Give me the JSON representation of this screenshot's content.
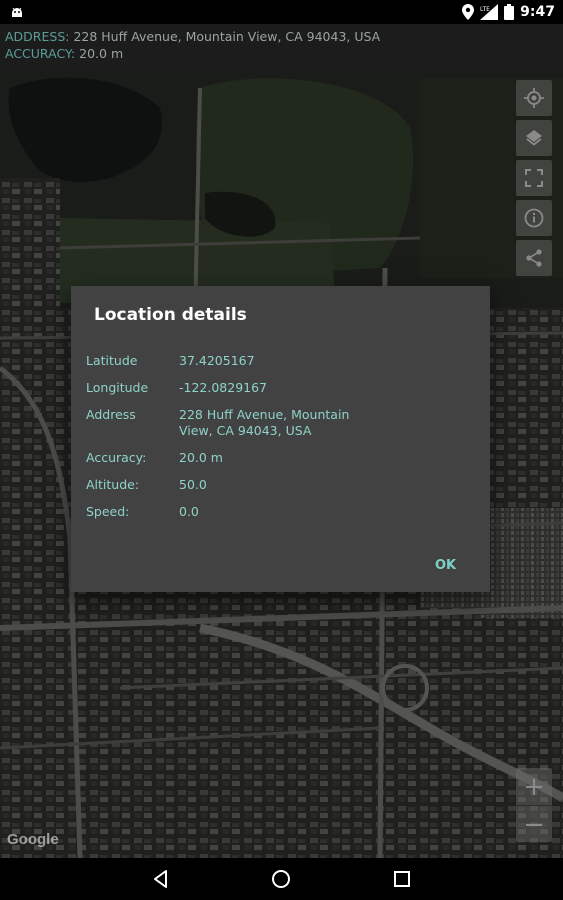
{
  "status_bar": {
    "time": "9:47",
    "network": "LTE",
    "icons": [
      "android-icon",
      "location-icon",
      "signal-icon",
      "battery-icon"
    ]
  },
  "info_header": {
    "address_label": "ADDRESS:",
    "address_value": "228 Huff Avenue, Mountain View, CA 94043, USA",
    "accuracy_label": "ACCURACY:",
    "accuracy_value": "20.0 m"
  },
  "map": {
    "type": "satellite",
    "attribution": "Google",
    "controls": [
      "my-location-icon",
      "layers-icon",
      "fullscreen-icon",
      "info-icon",
      "share-icon"
    ],
    "zoom_in": "+",
    "zoom_out": "−"
  },
  "dialog": {
    "title": "Location details",
    "rows": [
      {
        "label": "Latitude",
        "value": "37.4205167"
      },
      {
        "label": "Longitude",
        "value": "-122.0829167"
      },
      {
        "label": "Address",
        "value": "228 Huff Avenue, Mountain View, CA 94043, USA"
      },
      {
        "label": "Accuracy:",
        "value": "20.0 m"
      },
      {
        "label": "Altitude:",
        "value": "50.0"
      },
      {
        "label": "Speed:",
        "value": "0.0"
      }
    ],
    "ok_label": "OK"
  },
  "nav_bar": {
    "icons": [
      "back-icon",
      "home-icon",
      "recents-icon"
    ]
  },
  "colors": {
    "accent": "#7ed1c6",
    "dialog_bg": "#424242",
    "header_label": "#5b9d96"
  }
}
